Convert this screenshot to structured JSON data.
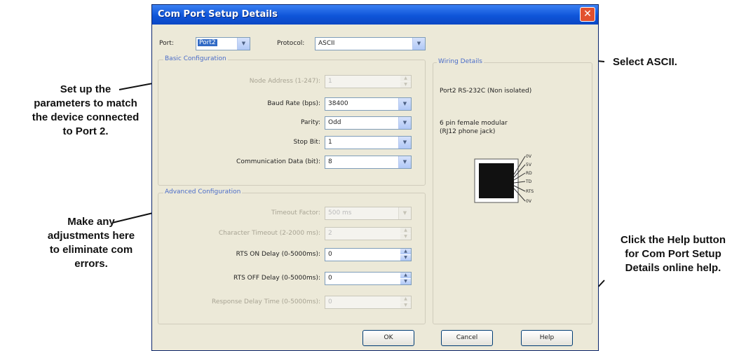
{
  "annotations": {
    "select_ascii": "Select ASCII.",
    "setup_params": [
      "Set up the",
      "parameters to match",
      "the device connected",
      "to Port 2."
    ],
    "adjustments": [
      "Make any",
      "adjustments here",
      "to eliminate com",
      "errors."
    ],
    "help": [
      "Click the Help button",
      "for Com Port Setup",
      "Details online help."
    ]
  },
  "dialog": {
    "title": "Com Port Setup Details",
    "close_glyph": "✕",
    "port": {
      "label": "Port:",
      "value": "Port2"
    },
    "protocol": {
      "label": "Protocol:",
      "value": "ASCII"
    },
    "basic": {
      "title": "Basic Configuration",
      "rows": [
        {
          "label": "Node Address (1-247):",
          "value": "1",
          "control": "spin",
          "disabled": true
        },
        {
          "label": "Baud Rate (bps):",
          "value": "38400",
          "control": "combo",
          "disabled": false
        },
        {
          "label": "Parity:",
          "value": "Odd",
          "control": "combo",
          "disabled": false
        },
        {
          "label": "Stop Bit:",
          "value": "1",
          "control": "combo",
          "disabled": false
        },
        {
          "label": "Communication Data (bit):",
          "value": "8",
          "control": "combo",
          "disabled": false
        }
      ]
    },
    "advanced": {
      "title": "Advanced Configuration",
      "rows": [
        {
          "label": "Timeout Factor:",
          "value": "500 ms",
          "control": "combo",
          "disabled": true
        },
        {
          "label": "Character Timeout (2-2000 ms):",
          "value": "2",
          "control": "spin",
          "disabled": true
        },
        {
          "label": "RTS ON Delay (0-5000ms):",
          "value": "0",
          "control": "spin",
          "disabled": false
        },
        {
          "label": "RTS OFF Delay (0-5000ms):",
          "value": "0",
          "control": "spin",
          "disabled": false
        },
        {
          "label": "Response Delay Time (0-5000ms):",
          "value": "0",
          "control": "spin",
          "disabled": true
        }
      ]
    },
    "wiring": {
      "title": "Wiring Details",
      "line1": "Port2 RS-232C (Non isolated)",
      "line2": "6 pin female modular",
      "line3": "(RJ12 phone jack)",
      "pins": [
        "0V",
        "5V",
        "RD",
        "TD",
        "RTS",
        "0V"
      ]
    },
    "buttons": {
      "ok": "OK",
      "cancel": "Cancel",
      "help": "Help"
    }
  }
}
